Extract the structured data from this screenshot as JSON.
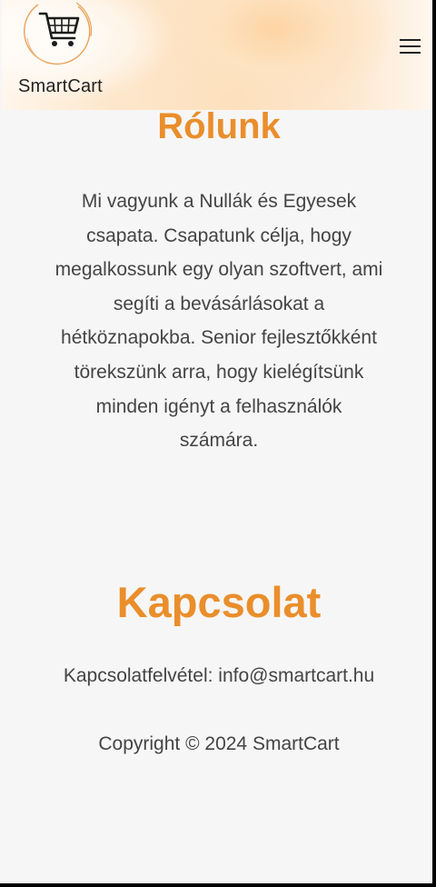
{
  "header": {
    "brand": "SmartCart",
    "logo_icon": "shopping-cart-icon",
    "menu_icon": "hamburger-menu-icon"
  },
  "about": {
    "title": "Rólunk",
    "text": "Mi vagyunk a Nullák és Egyesek csapata. Csapatunk célja, hogy megalkossunk egy olyan szoftvert, ami segíti a bevásárlásokat a hétköznapokba. Senior fejlesztőkként törekszünk arra, hogy kielégítsünk minden igényt a felhasználók számára."
  },
  "contact": {
    "title": "Kapcsolat",
    "line": "Kapcsolatfelvétel: info@smartcart.hu"
  },
  "footer": {
    "copyright": "Copyright © 2024 SmartCart"
  },
  "colors": {
    "accent": "#ea8e2b",
    "text": "#444444",
    "background": "#f6f6f6"
  }
}
